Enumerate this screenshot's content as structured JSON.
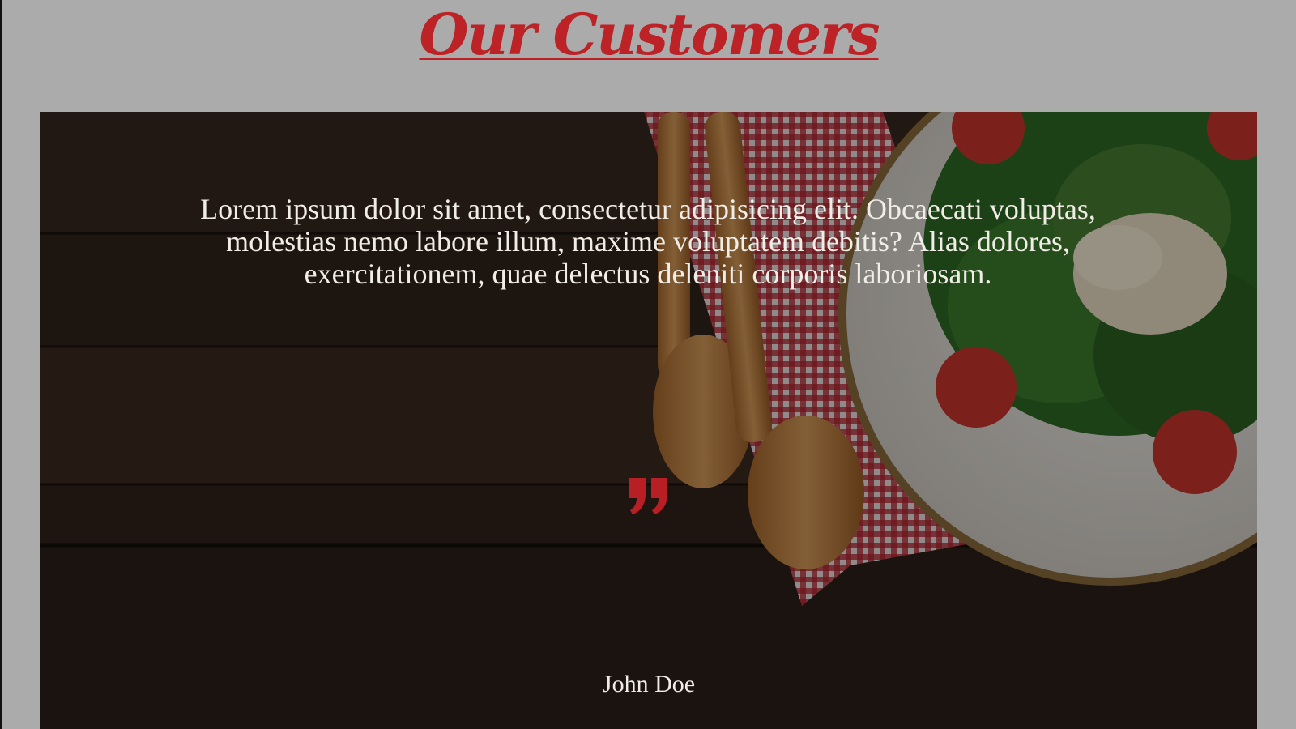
{
  "page": {
    "title": "Our Customers"
  },
  "testimonial": {
    "quote": "Lorem ipsum dolor sit amet, consectetur adipisicing elit. Obcaecati voluptas, molestias nemo labore illum, maxime voluptatem debitis? Alias dolores, exercitationem, quae delectus deleniti corporis laboriosam.",
    "author": "John Doe",
    "quote_icon": "quote-right-icon",
    "background_image": "food-table-photo"
  },
  "colors": {
    "accent": "#bc2226",
    "page_background": "#ababab",
    "text_light": "#f0ece6"
  }
}
